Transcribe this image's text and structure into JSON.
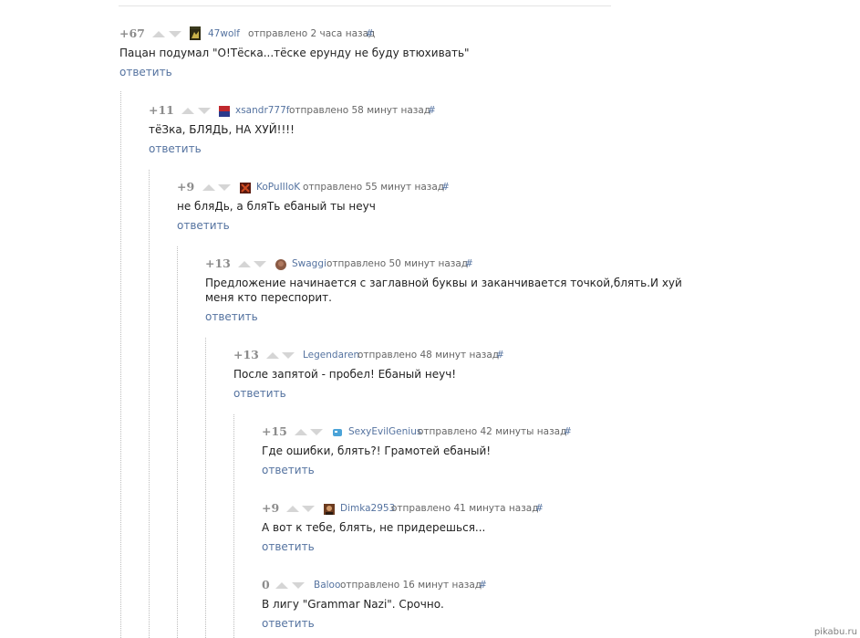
{
  "sent_label": "отправлено",
  "reply_label": "ответить",
  "anchor_label": "#",
  "comments": [
    {
      "rating": "+67",
      "user": "47wolf",
      "time": "2 часа назад",
      "text": "Пацан подумал \"О!Тёска...тёске ерунду не буду втюхивать\"",
      "avatar_color": "#3a3a1c"
    },
    {
      "rating": "+11",
      "user": "xsandr777f",
      "time": "58 минут назад",
      "text": "тёЗка, БЛЯДЬ, НА ХУЙ!!!!",
      "avatar_color": "#c0282d"
    },
    {
      "rating": "+9",
      "user": "KoPuIIIoK",
      "time": "55 минут назад",
      "text": "не бляДь, а бляТь ебаный ты неуч",
      "avatar_color": "#5a1a10"
    },
    {
      "rating": "+13",
      "user": "Swaggi",
      "time": "50 минут назад",
      "text": "Предложение начинается с заглавной буквы и заканчивается точкой,блять.И хуй меня кто переспорит.",
      "avatar_color": "#8a5a44"
    },
    {
      "rating": "+13",
      "user": "Legendaren",
      "time": "48 минут назад",
      "text": "После запятой - пробел! Ебаный неуч!",
      "avatar_color": ""
    },
    {
      "rating": "+15",
      "user": "SexyEvilGenius",
      "time": "42 минуты назад",
      "text": "Где ошибки, блять?! Грамотей ебаный!",
      "avatar_color": "#4aa3d8"
    },
    {
      "rating": "+9",
      "user": "Dimka2953",
      "time": "41 минута назад",
      "text": "А вот к тебе, блять, не придерешься...",
      "avatar_color": "#6b3b1f"
    },
    {
      "rating": "0",
      "user": "Baloo",
      "time": "16 минут назад",
      "text": "В лигу \"Grammar Nazi\". Срочно.",
      "avatar_color": ""
    }
  ],
  "watermark": "pikabu.ru"
}
